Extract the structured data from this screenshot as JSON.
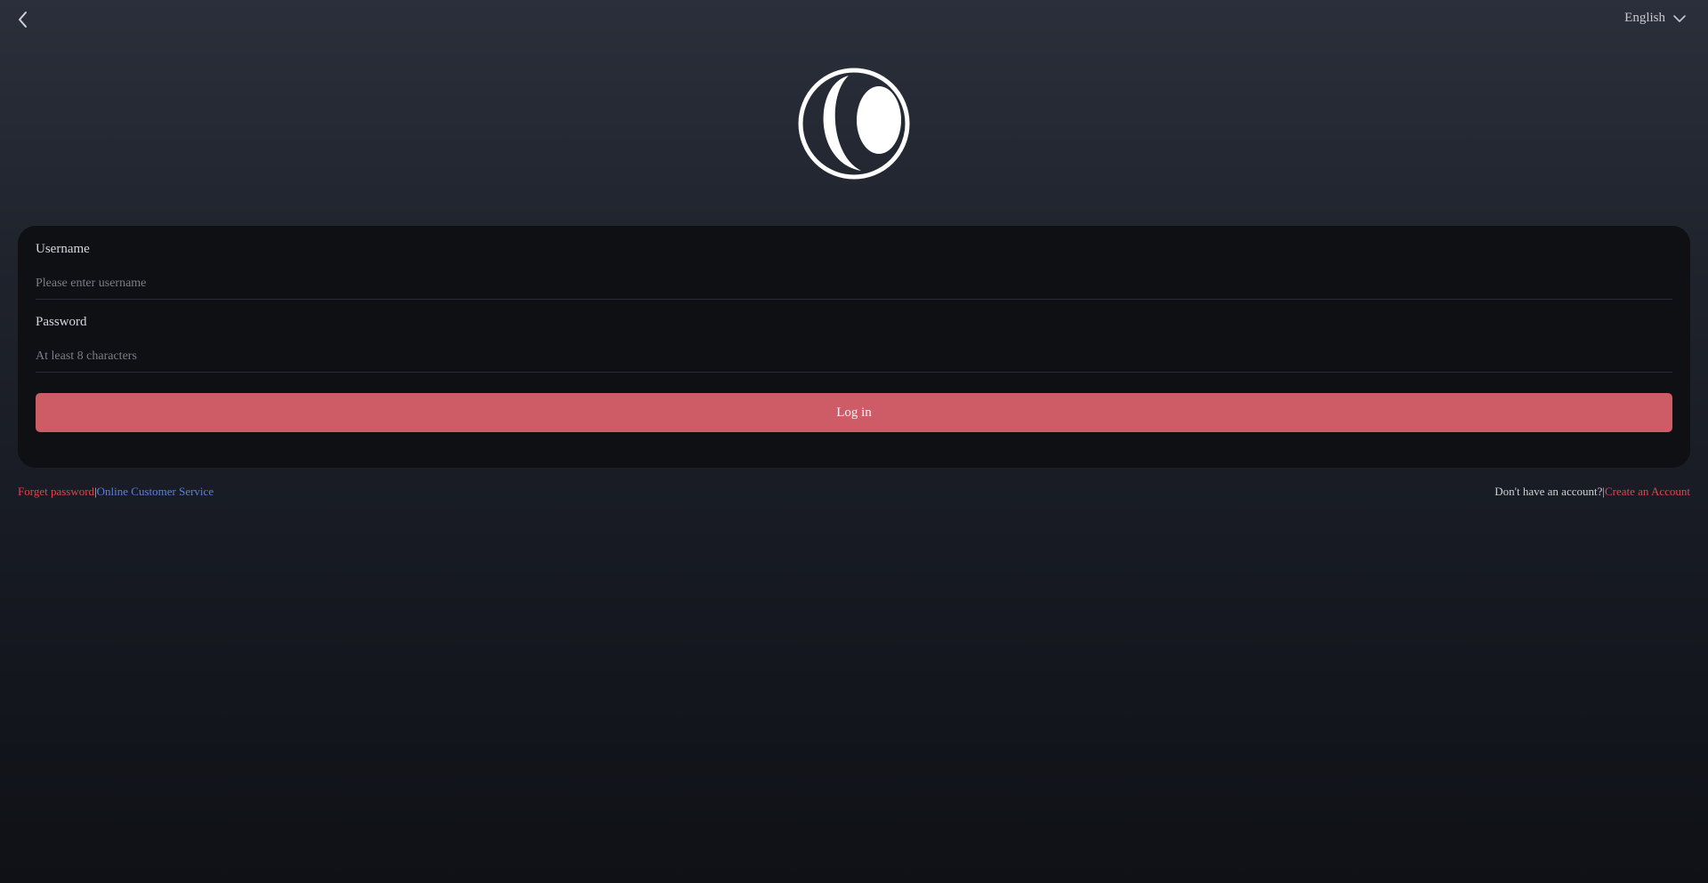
{
  "header": {
    "back_icon": "chevron-left-icon",
    "language_label": "English",
    "language_icon": "chevron-down-icon"
  },
  "logo": {
    "icon": "crescent-moon-logo"
  },
  "form": {
    "username_label": "Username",
    "username_placeholder": "Please enter username",
    "username_value": "",
    "password_label": "Password",
    "password_placeholder": "At least 8 characters",
    "password_value": "",
    "login_label": "Log in"
  },
  "footer": {
    "forget_password": "Forget password",
    "separator": "|",
    "customer_service": "Online Customer Service",
    "no_account": "Don't have an account?",
    "create_account": "Create an Account"
  },
  "colors": {
    "accent_button": "#cd5c67",
    "link_red": "#e0444e",
    "link_blue": "#5f7fd9",
    "card_bg": "#0f1014"
  }
}
